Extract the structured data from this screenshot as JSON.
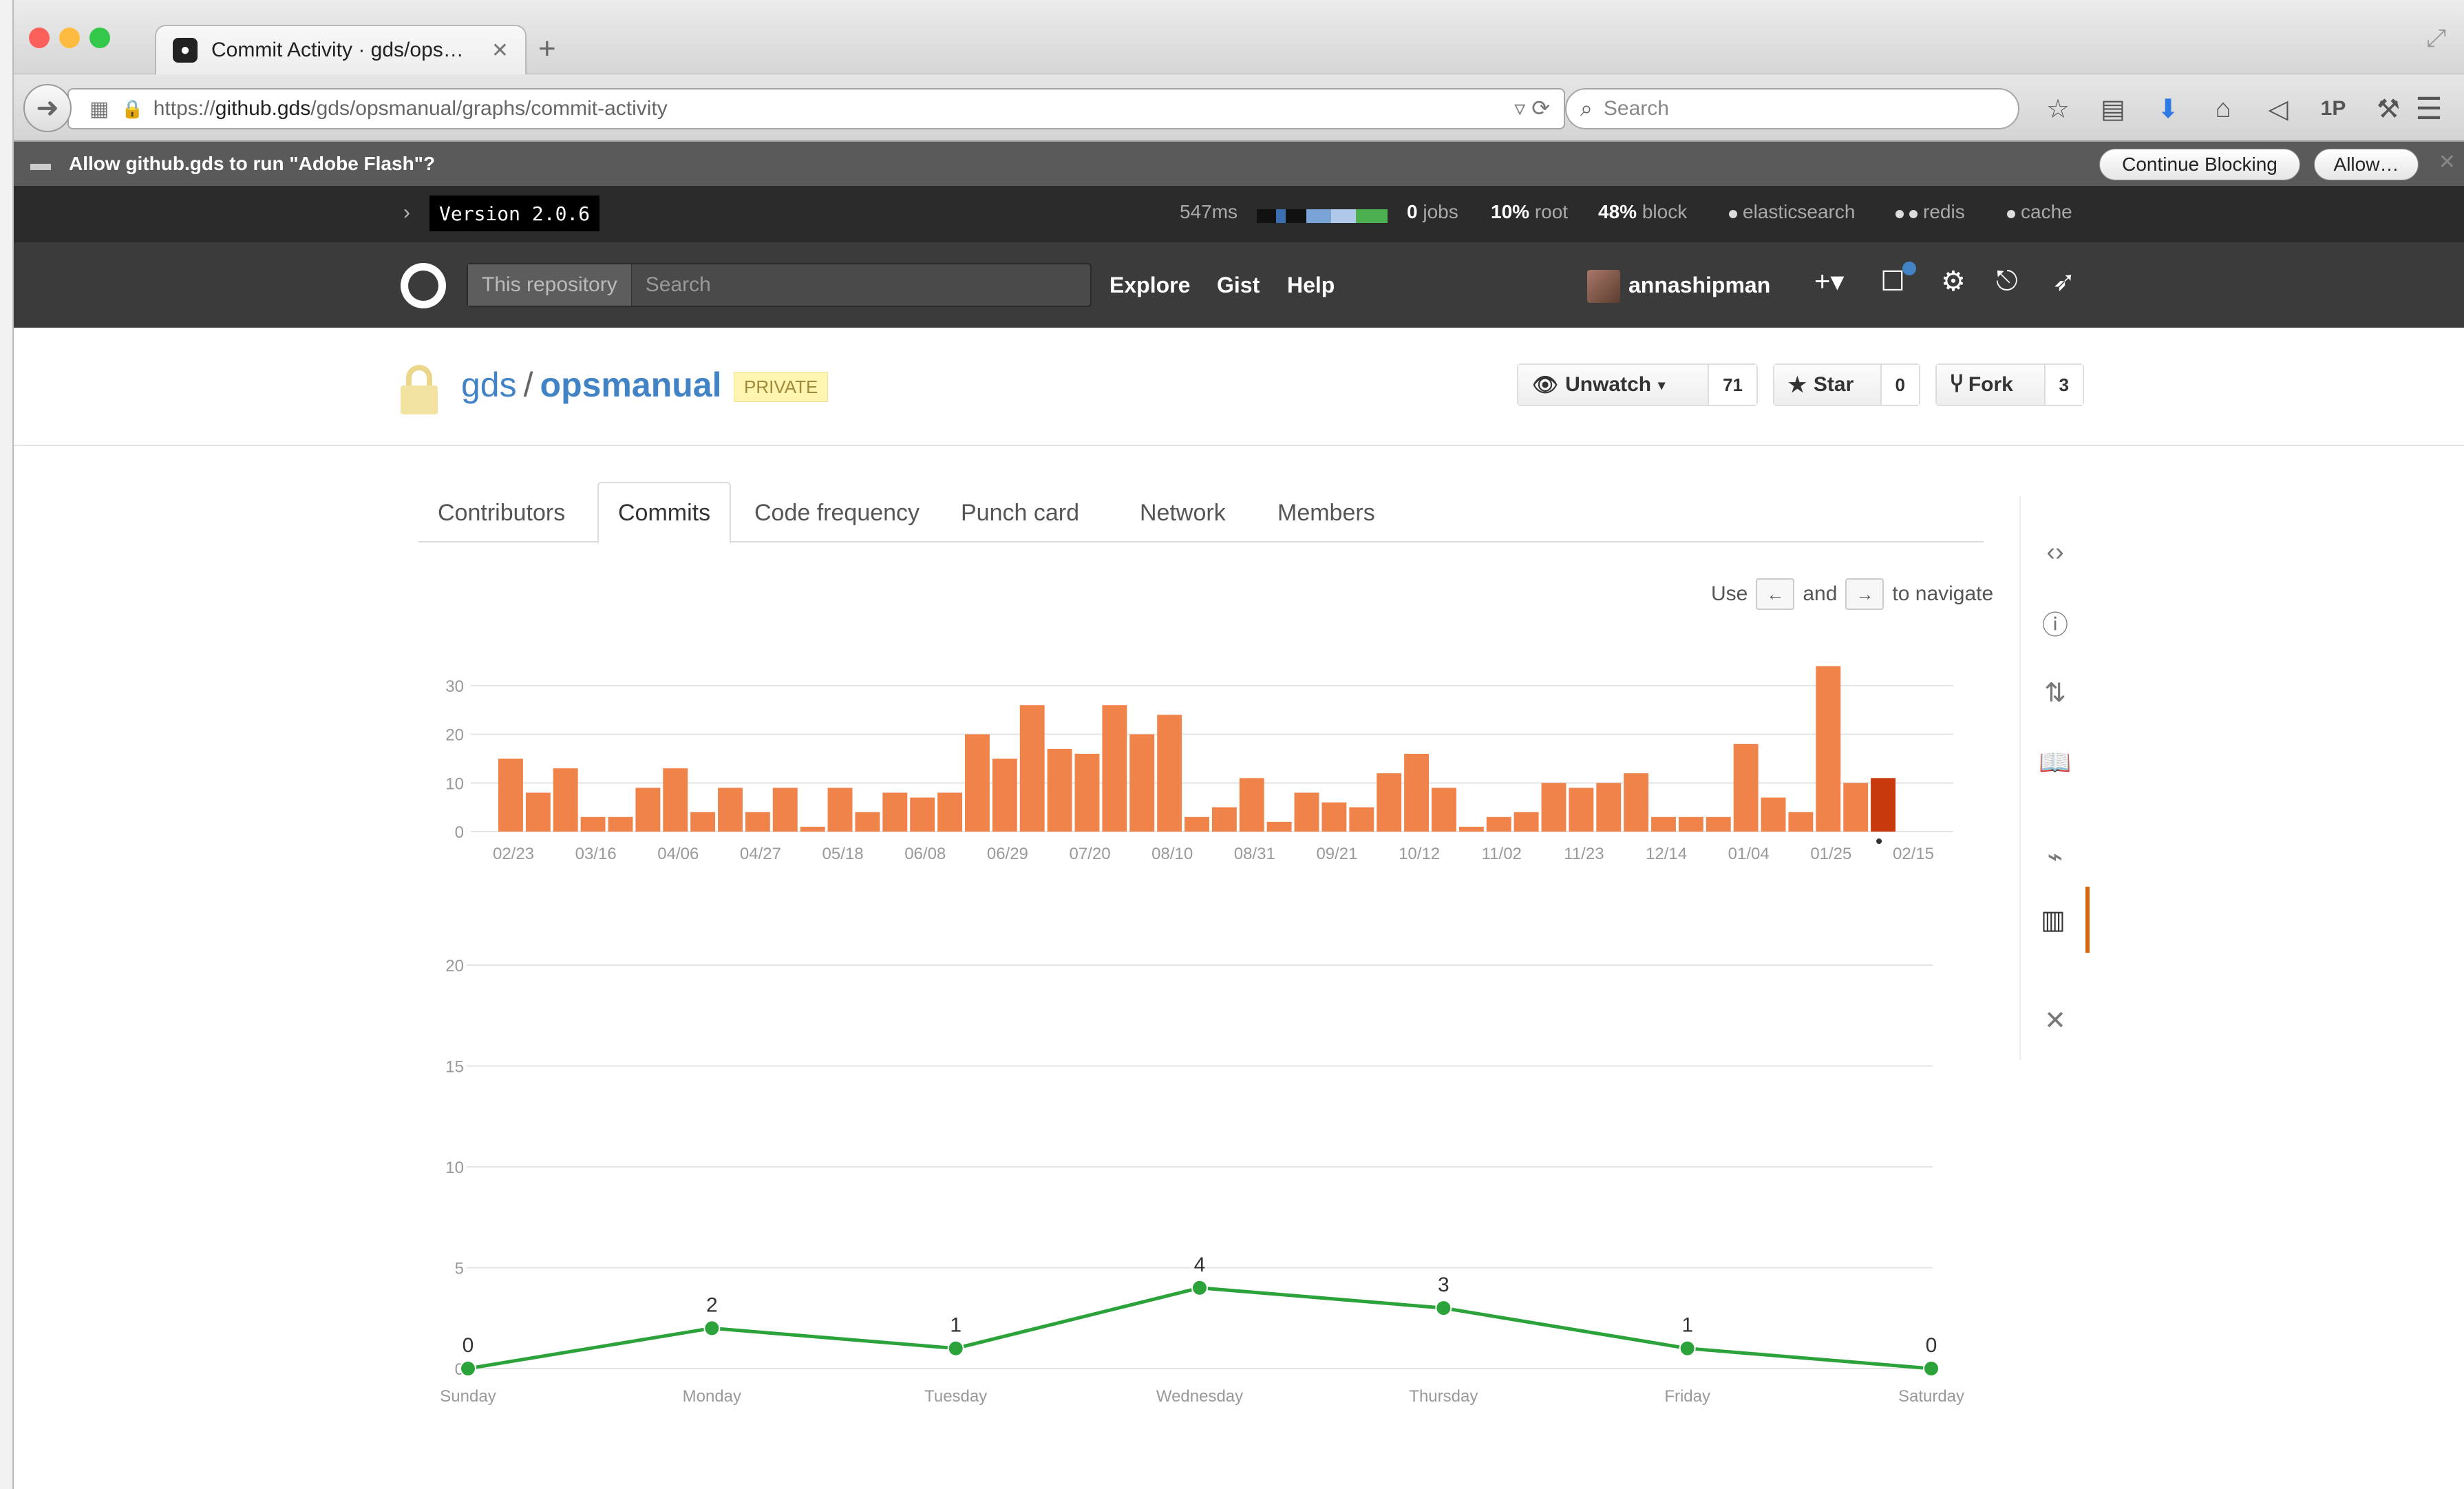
{
  "browser": {
    "tab_title": "Commit Activity · gds/ops…",
    "tab_close": "✕",
    "new_tab": "+",
    "url_scheme": "https://",
    "url_host": "github.gds",
    "url_path": "/gds/opsmanual/graphs/commit-activity",
    "search_placeholder": "Search",
    "traffic_lights": [
      "#fc605b",
      "#fdbc40",
      "#34c84a"
    ]
  },
  "flash_prompt": {
    "message": "Allow github.gds to run \"Adobe Flash\"?",
    "continue_label": "Continue Blocking",
    "allow_label": "Allow…"
  },
  "staff_bar": {
    "version": "Version 2.0.6",
    "time": "547ms",
    "jobs_value": "0",
    "jobs_label": "jobs",
    "root_value": "10%",
    "root_label": "root",
    "block_value": "48%",
    "block_label": "block",
    "services": [
      "elasticsearch",
      "redis",
      "cache"
    ]
  },
  "header": {
    "search_scope": "This repository",
    "search_placeholder": "Search",
    "nav": [
      "Explore",
      "Gist",
      "Help"
    ],
    "username": "annashipman"
  },
  "repo": {
    "owner": "gds",
    "separator": "/",
    "name": "opsmanual",
    "visibility": "PRIVATE",
    "watch_label": "Unwatch",
    "watch_count": "71",
    "star_label": "Star",
    "star_count": "0",
    "fork_label": "Fork",
    "fork_count": "3"
  },
  "graph_tabs": [
    "Contributors",
    "Commits",
    "Code frequency",
    "Punch card",
    "Network",
    "Members"
  ],
  "active_tab": "Commits",
  "nav_hint": {
    "use": "Use",
    "left_key": "←",
    "and": "and",
    "right_key": "→",
    "suffix": "to navigate"
  },
  "sidebar_icons": [
    "code-icon",
    "issues-icon",
    "pull-request-icon",
    "wiki-icon",
    "pulse-icon",
    "graphs-icon",
    "settings-icon"
  ],
  "chart_data": [
    {
      "type": "bar",
      "title": "",
      "ylim": [
        0,
        30
      ],
      "yticks": [
        0,
        10,
        20,
        30
      ],
      "xtick_labels": [
        "02/23",
        "03/16",
        "04/06",
        "04/27",
        "05/18",
        "06/08",
        "06/29",
        "07/20",
        "08/10",
        "08/31",
        "09/21",
        "10/12",
        "11/02",
        "11/23",
        "12/14",
        "01/04",
        "01/25",
        "02/15"
      ],
      "values": [
        15,
        8,
        13,
        3,
        3,
        9,
        13,
        4,
        9,
        4,
        9,
        1,
        9,
        4,
        8,
        7,
        8,
        20,
        15,
        26,
        17,
        16,
        26,
        20,
        24,
        3,
        5,
        11,
        2,
        8,
        6,
        5,
        12,
        16,
        9,
        1,
        3,
        4,
        10,
        9,
        10,
        12,
        3,
        3,
        3,
        18,
        7,
        4,
        34,
        10,
        11
      ],
      "selected_index": 50,
      "bar_color": "#f0834a",
      "selected_color": "#c83a0e"
    },
    {
      "type": "line",
      "categories": [
        "Sunday",
        "Monday",
        "Tuesday",
        "Wednesday",
        "Thursday",
        "Friday",
        "Saturday"
      ],
      "values": [
        0,
        2,
        1,
        4,
        3,
        1,
        0
      ],
      "ylim": [
        0,
        20
      ],
      "yticks": [
        0,
        5,
        10,
        15,
        20
      ],
      "line_color": "#2ca33a"
    }
  ]
}
